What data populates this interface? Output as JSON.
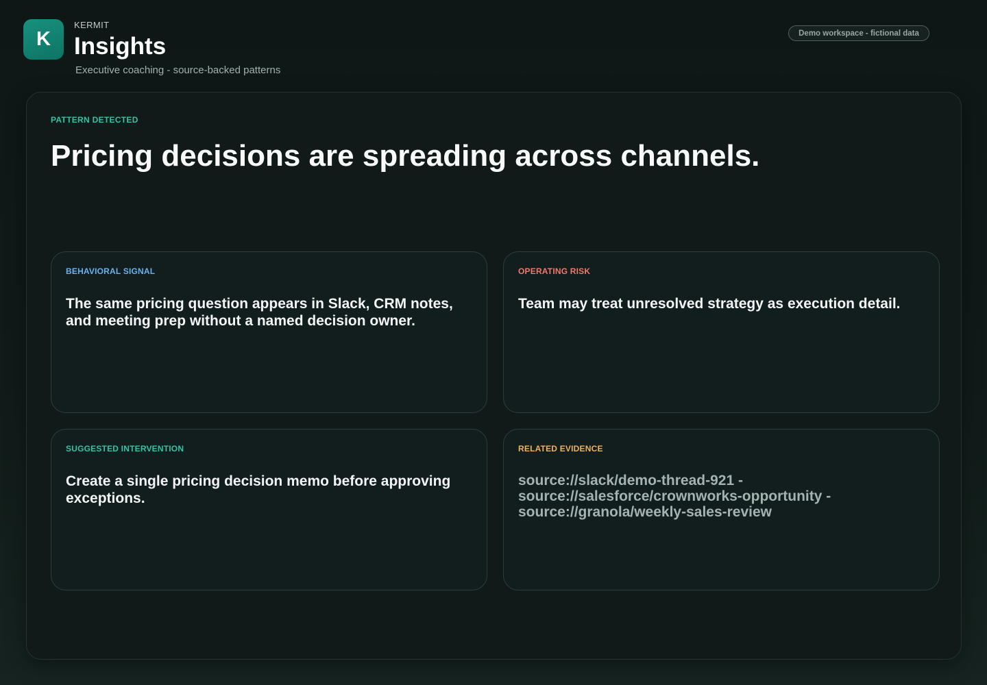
{
  "header": {
    "logo_letter": "K",
    "brand": "KERMIT",
    "title": "Insights",
    "subtitle": "Executive coaching - source-backed patterns",
    "badge": "Demo workspace - fictional data"
  },
  "pattern": {
    "label": "PATTERN DETECTED",
    "title": "Pricing decisions are spreading across channels."
  },
  "cards": {
    "behavioral_signal": {
      "label": "BEHAVIORAL SIGNAL",
      "label_color": "#6ab2ee",
      "body": "The same pricing question appears in Slack, CRM notes, and meeting prep without a named decision owner."
    },
    "operating_risk": {
      "label": "OPERATING RISK",
      "label_color": "#ee7a6e",
      "body": "Team may treat unresolved strategy as execution detail."
    },
    "suggested_intervention": {
      "label": "SUGGESTED INTERVENTION",
      "label_color": "#2fc4a6",
      "body": "Create a single pricing decision memo before approving exceptions."
    },
    "related_evidence": {
      "label": "RELATED EVIDENCE",
      "label_color": "#eeb259",
      "sources": [
        "source://slack/demo-thread-921 -",
        "source://salesforce/crownworks-opportunity -",
        "source://granola/weekly-sales-review"
      ]
    }
  },
  "colors": {
    "accent": "#18907e",
    "background": "#0e1716",
    "panel": "#111a19",
    "card": "#121e1d"
  }
}
